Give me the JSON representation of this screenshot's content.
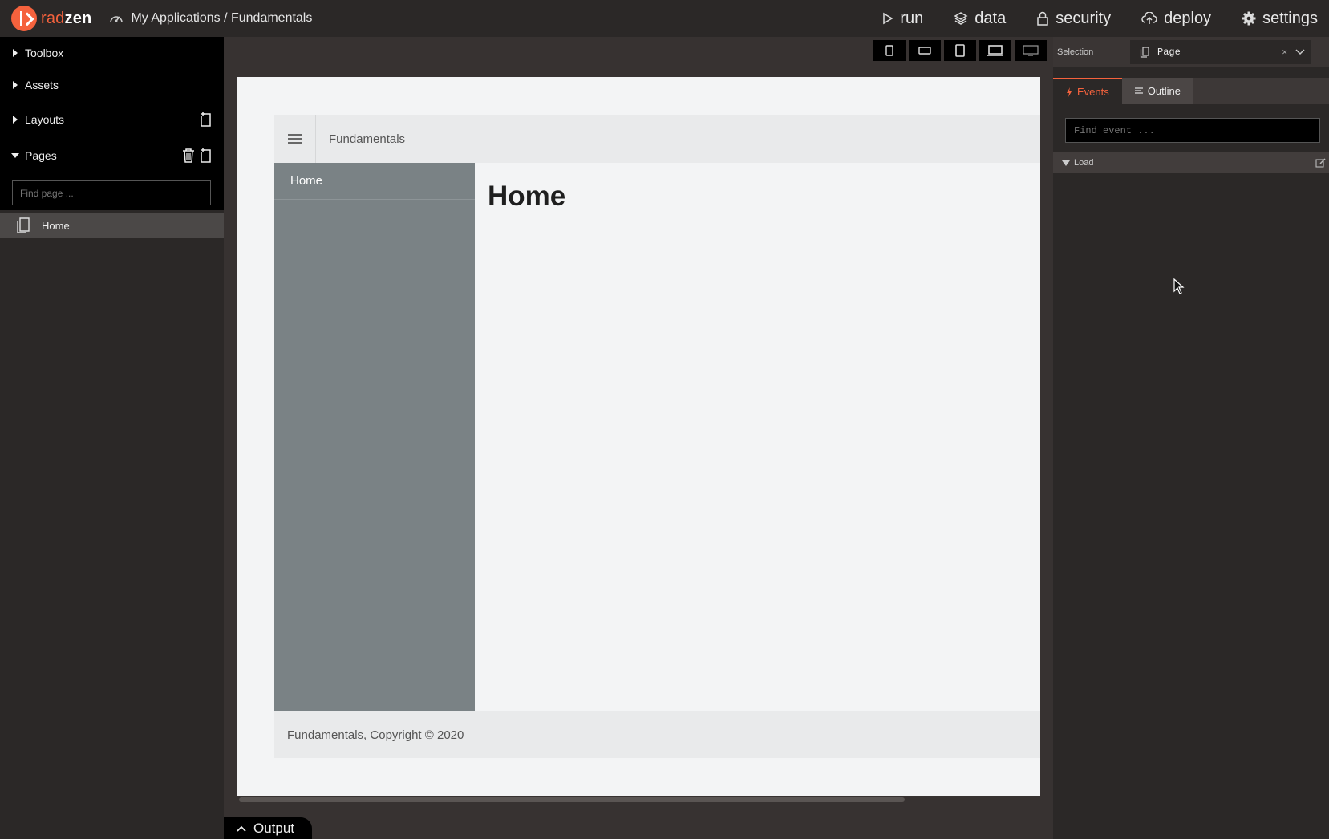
{
  "brand": {
    "prefix": "rad",
    "suffix": "zen",
    "accent": "#f5623d"
  },
  "breadcrumb": "My Applications / Fundamentals",
  "nav": [
    {
      "label": "run",
      "icon": "play-icon"
    },
    {
      "label": "data",
      "icon": "layers-icon"
    },
    {
      "label": "security",
      "icon": "lock-icon"
    },
    {
      "label": "deploy",
      "icon": "cloud-upload-icon"
    },
    {
      "label": "settings",
      "icon": "gear-icon"
    }
  ],
  "left": {
    "sections": {
      "toolbox": "Toolbox",
      "assets": "Assets",
      "layouts": "Layouts",
      "pages": "Pages"
    },
    "find_page_placeholder": "Find page ...",
    "pages": [
      {
        "label": "Home"
      }
    ]
  },
  "canvas": {
    "devices": [
      "mobile-portrait-icon",
      "mobile-landscape-icon",
      "tablet-portrait-icon",
      "tablet-landscape-icon",
      "desktop-icon"
    ],
    "app_title": "Fundamentals",
    "sidebar_item": "Home",
    "heading": "Home",
    "footer": "Fundamentals, Copyright © 2020",
    "output_label": "Output"
  },
  "right": {
    "selection_label": "Selection",
    "selection_value": "Page",
    "tabs": {
      "events": "Events",
      "outline": "Outline"
    },
    "find_event_placeholder": "Find event ...",
    "events": [
      {
        "label": "Load"
      }
    ]
  }
}
